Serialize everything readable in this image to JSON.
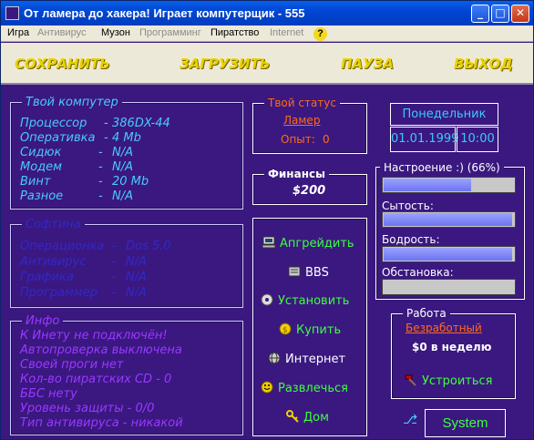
{
  "window": {
    "title": "От ламера до хакера! Играет компутерщик - 555",
    "minimize": "_",
    "maximize": "□",
    "close": "✕"
  },
  "menu": {
    "items": [
      {
        "label": "Игра",
        "enabled": true
      },
      {
        "label": "Антивирус",
        "enabled": false
      },
      {
        "label": "Музон",
        "enabled": true
      },
      {
        "label": "Программинг",
        "enabled": false
      },
      {
        "label": "Пиратство",
        "enabled": true
      },
      {
        "label": "Internet",
        "enabled": false
      }
    ],
    "help": "?"
  },
  "toolbar": {
    "save": "СОХРАНИТЬ",
    "load": "ЗАГРУЗИТЬ",
    "pause": "ПАУЗА",
    "exit": "ВЫХОД"
  },
  "computer": {
    "legend": "Твой компутер",
    "rows": [
      {
        "label": "Процессор",
        "sep": "-",
        "value": "386DX-44"
      },
      {
        "label": "Оперативка",
        "sep": "-",
        "value": "4 Mb"
      },
      {
        "label": "Сидюк",
        "sep": "-",
        "value": "N/A"
      },
      {
        "label": "Модем",
        "sep": "-",
        "value": "N/A"
      },
      {
        "label": "Винт",
        "sep": "-",
        "value": "20 Mb"
      },
      {
        "label": "Разное",
        "sep": "-",
        "value": "N/A"
      }
    ]
  },
  "software": {
    "legend": "Софтина",
    "rows": [
      {
        "label": "Операционка",
        "sep": "-",
        "value": "Dos 5.0"
      },
      {
        "label": "Антивирус",
        "sep": "-",
        "value": "N/A"
      },
      {
        "label": "Графика",
        "sep": "-",
        "value": "N/A"
      },
      {
        "label": "Программер",
        "sep": "-",
        "value": "N/A"
      }
    ]
  },
  "info": {
    "legend": "Инфо",
    "lines": [
      "К Инету не подключён!",
      "Автопроверка выключена",
      "Своей проги нет",
      "Кол-во пиратских CD - 0",
      "ББС нету",
      "Уровень защиты - 0/0",
      "Тип антивируса - никакой"
    ]
  },
  "status": {
    "legend": "Твой статус",
    "rank": "Ламер",
    "exp_label": "Опыт:",
    "exp_value": "0"
  },
  "finance": {
    "legend": "Финансы",
    "amount": "$200"
  },
  "actions": {
    "upgrade": "Апгрейдить",
    "bbs": "BBS",
    "install": "Установить",
    "buy": "Купить",
    "internet": "Интернет",
    "fun": "Развлечься",
    "home": "Дом"
  },
  "date": {
    "weekday": "Понедельник",
    "date": "01.01.1999",
    "time": "10:00"
  },
  "meters": {
    "mood": {
      "label": "Настроение :) (66%)",
      "fraction": 0.66
    },
    "satiety": {
      "label": "Сытость:",
      "fraction": 0.97
    },
    "vigor": {
      "label": "Бодрость:",
      "fraction": 0.97
    },
    "setting": {
      "label": "Обстановка:",
      "fraction": 0.0
    }
  },
  "job": {
    "legend": "Работа",
    "title": "Безработный",
    "salary": "$0 в неделю",
    "apply": "Устроиться"
  },
  "system": {
    "label": "System"
  },
  "colors": {
    "background": "#3a1880",
    "accent_text": "#4cc8ff",
    "action_green": "#3cff3c",
    "status_orange": "#ff6a1a",
    "toolbar_gold": "#e8d000"
  }
}
